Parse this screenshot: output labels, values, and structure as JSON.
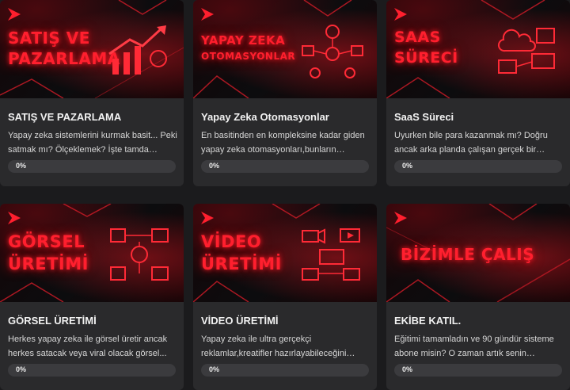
{
  "cards": [
    {
      "hero_lines": [
        "SATIŞ VE",
        "PAZARLAMA"
      ],
      "title": "SATIŞ VE PAZARLAMA",
      "description": "Yapay zeka sistemlerini kurmak basit... Peki satmak mı? Ölçeklemek? İşte tamda burada...",
      "progress_label": "0%",
      "progress": 0,
      "icon": "chart-growth-icon"
    },
    {
      "hero_lines": [
        "YAPAY ZEKA",
        "OTOMASYONLAR"
      ],
      "title": "Yapay Zeka Otomasyonlar",
      "description": "En basitinden en kompleksine kadar giden yapay zeka otomasyonları,bunların mantığını...",
      "progress_label": "0%",
      "progress": 0,
      "icon": "automation-flow-icon"
    },
    {
      "hero_lines": [
        "SAAS",
        "SÜRECİ"
      ],
      "title": "SaaS Süreci",
      "description": "Uyurken bile para kazanmak mı? Doğru ancak arka planda çalışan gerçek bir sistem...",
      "progress_label": "0%",
      "progress": 0,
      "icon": "cloud-saas-icon"
    },
    {
      "hero_lines": [
        "GÖRSEL",
        "ÜRETİMİ"
      ],
      "title": "GÖRSEL ÜRETİMİ",
      "description": "Herkes yapay zeka ile görsel üretir ancak herkes satacak veya viral olacak görsel...",
      "progress_label": "0%",
      "progress": 0,
      "icon": "image-generation-icon"
    },
    {
      "hero_lines": [
        "VİDEO",
        "ÜRETİMİ"
      ],
      "title": "VİDEO ÜRETİMİ",
      "description": "Yapay zeka ile ultra gerçekçi reklamlar,kreatifler hazırlayabileceğini biliyo...",
      "progress_label": "0%",
      "progress": 0,
      "icon": "video-camera-icon"
    },
    {
      "hero_lines": [
        "BİZİMLE ÇALIŞ"
      ],
      "title": "EKİBE KATIL.",
      "description": "Eğitimi tamamladın ve 90 gündür sisteme abone misin? O zaman artık senin fikirlerin...",
      "progress_label": "0%",
      "progress": 0,
      "icon": ""
    }
  ],
  "accent_color": "#e21b2c"
}
